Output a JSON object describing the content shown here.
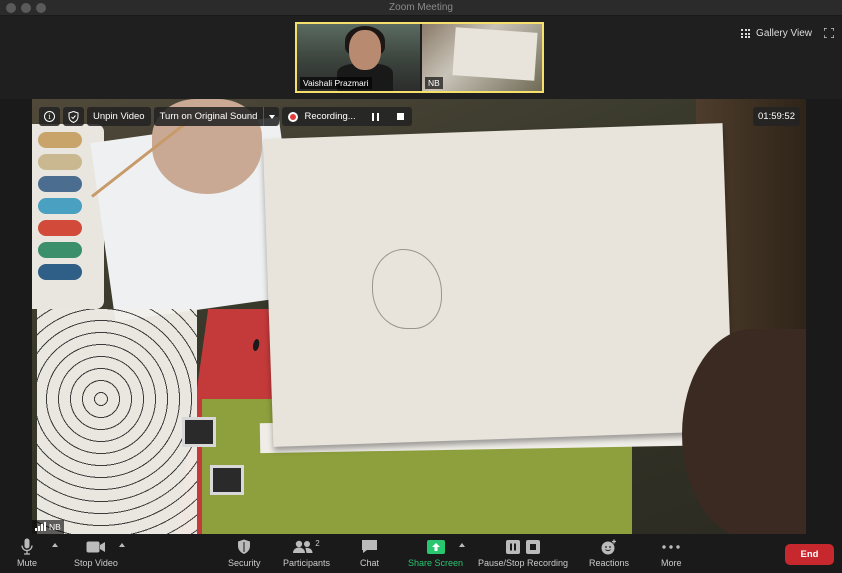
{
  "window": {
    "title": "Zoom Meeting"
  },
  "thumbnails": [
    {
      "name": "Vaishali Prazmari"
    },
    {
      "name": "NB"
    }
  ],
  "top_right": {
    "gallery_view": "Gallery View"
  },
  "video_controls": {
    "unpin": "Unpin Video",
    "original_sound": "Turn on Original Sound",
    "recording": "Recording...",
    "timer": "01:59:52"
  },
  "main_video": {
    "participant": "NB"
  },
  "toolbar": {
    "mute": "Mute",
    "stop_video": "Stop Video",
    "security": "Security",
    "participants": "Participants",
    "participants_count": "2",
    "chat": "Chat",
    "share_screen": "Share Screen",
    "pause_stop_recording": "Pause/Stop Recording",
    "reactions": "Reactions",
    "more": "More",
    "end": "End"
  },
  "colors": {
    "active_speaker_border": "#f4e06a",
    "share_green": "#28c76f",
    "end_red": "#c7282e",
    "record_red": "#e23d3d"
  }
}
